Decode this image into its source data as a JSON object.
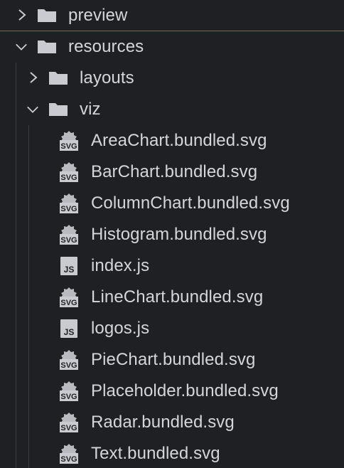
{
  "folders": {
    "preview": "preview",
    "resources": "resources",
    "layouts": "layouts",
    "viz": "viz"
  },
  "files": [
    {
      "label": "AreaChart.bundled.svg",
      "type": "svg-file-icon"
    },
    {
      "label": "BarChart.bundled.svg",
      "type": "svg-file-icon"
    },
    {
      "label": "ColumnChart.bundled.svg",
      "type": "svg-file-icon"
    },
    {
      "label": "Histogram.bundled.svg",
      "type": "svg-file-icon"
    },
    {
      "label": "index.js",
      "type": "js-file-icon"
    },
    {
      "label": "LineChart.bundled.svg",
      "type": "svg-file-icon"
    },
    {
      "label": "logos.js",
      "type": "js-file-icon"
    },
    {
      "label": "PieChart.bundled.svg",
      "type": "svg-file-icon"
    },
    {
      "label": "Placeholder.bundled.svg",
      "type": "svg-file-icon"
    },
    {
      "label": "Radar.bundled.svg",
      "type": "svg-file-icon"
    },
    {
      "label": "Text.bundled.svg",
      "type": "svg-file-icon"
    }
  ],
  "icon_labels": {
    "svg": "SVG",
    "js": "JS"
  },
  "colors": {
    "background": "#1f2023",
    "text": "#d4d6db",
    "icon": "#c9cbd0",
    "focus_line": "#3a6fc2"
  }
}
